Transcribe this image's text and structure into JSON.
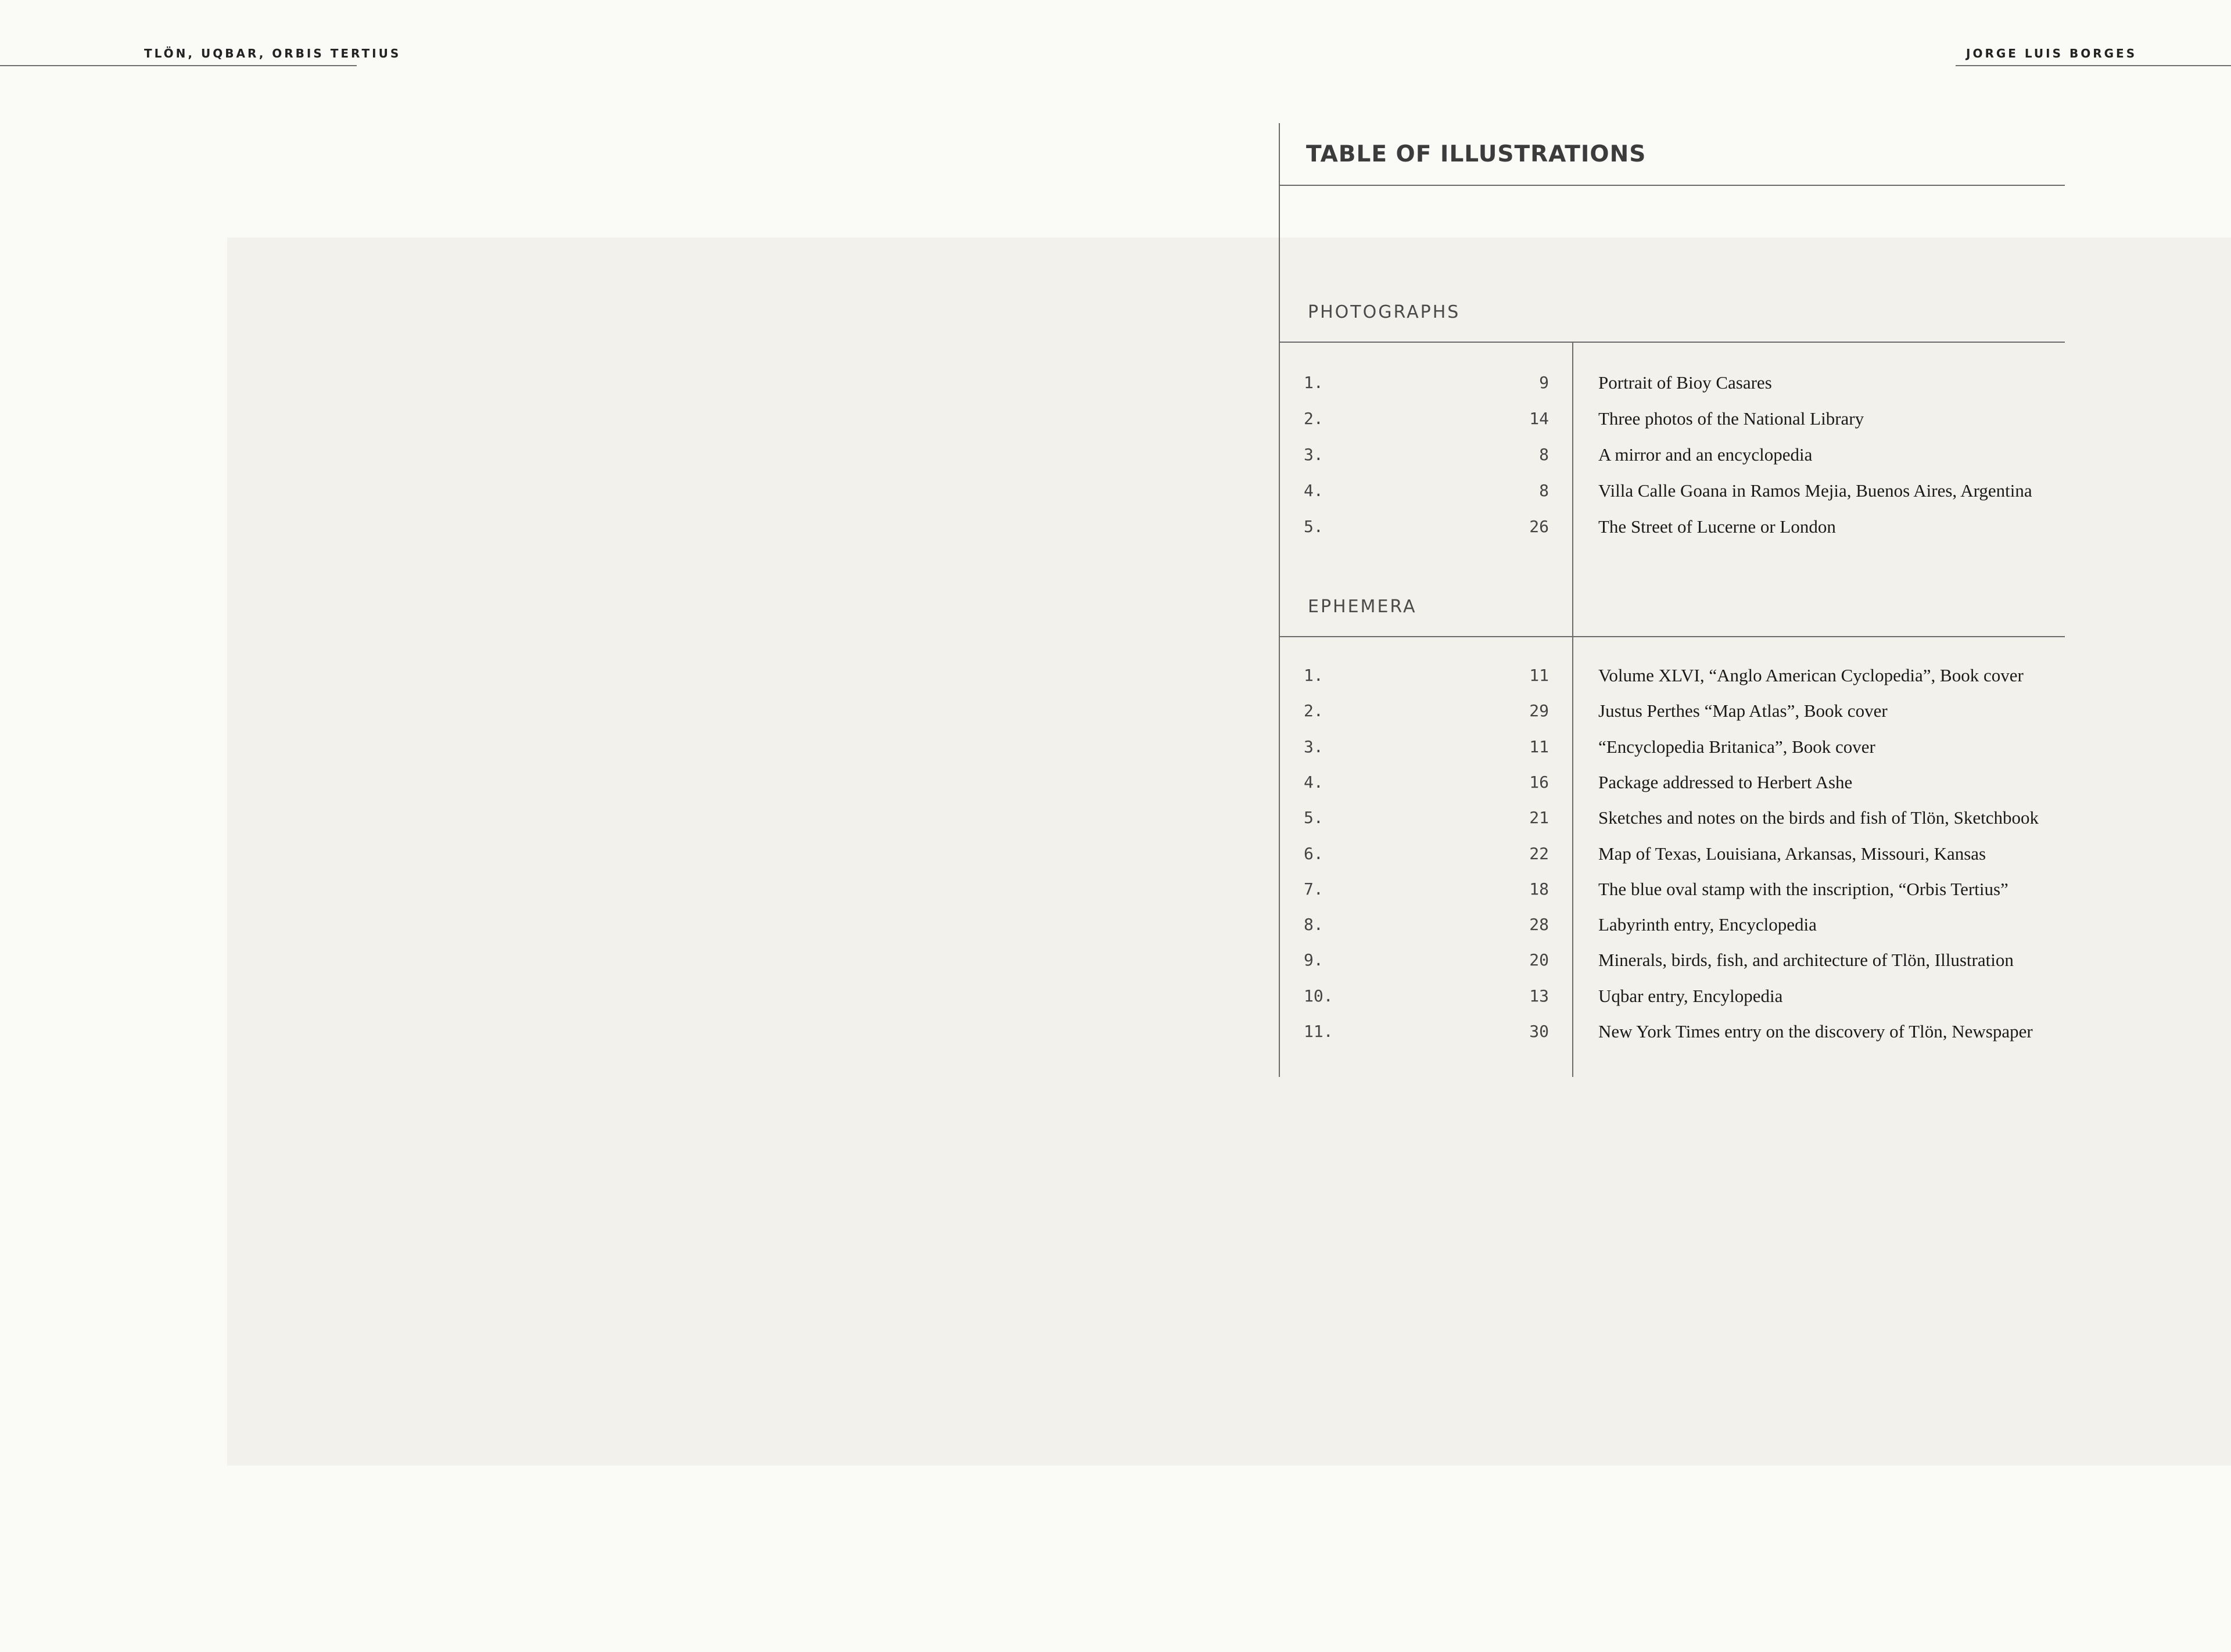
{
  "header": {
    "left": "TLÖN, UQBAR, ORBIS TERTIUS",
    "right": "JORGE LUIS BORGES"
  },
  "toc": {
    "title": "TABLE OF ILLUSTRATIONS",
    "sections": [
      {
        "heading": "PHOTOGRAPHS",
        "items": [
          {
            "num": "1.",
            "page": "9",
            "desc": "Portrait of Bioy Casares"
          },
          {
            "num": "2.",
            "page": "14",
            "desc": "Three photos of the National Library"
          },
          {
            "num": "3.",
            "page": "8",
            "desc": "A mirror and an encyclopedia"
          },
          {
            "num": "4.",
            "page": "8",
            "desc": "Villa Calle Goana in Ramos Mejia, Buenos Aires, Argentina"
          },
          {
            "num": "5.",
            "page": "26",
            "desc": "The Street of Lucerne or London"
          }
        ]
      },
      {
        "heading": "EPHEMERA",
        "items": [
          {
            "num": "1.",
            "page": "11",
            "desc": "Volume XLVI, “Anglo American Cyclopedia”, Book cover"
          },
          {
            "num": "2.",
            "page": "29",
            "desc": "Justus Perthes “Map Atlas”, Book cover"
          },
          {
            "num": "3.",
            "page": "11",
            "desc": "“Encyclopedia Britanica”, Book cover"
          },
          {
            "num": "4.",
            "page": "16",
            "desc": "Package addressed to Herbert Ashe"
          },
          {
            "num": "5.",
            "page": "21",
            "desc": "Sketches and notes on the birds and fish of Tlön, Sketchbook"
          },
          {
            "num": "6.",
            "page": "22",
            "desc": "Map of Texas,  Louisiana, Arkansas, Missouri, Kansas"
          },
          {
            "num": "7.",
            "page": "18",
            "desc": "The blue oval stamp with the inscription, “Orbis Tertius”"
          },
          {
            "num": "8.",
            "page": "28",
            "desc": "Labyrinth entry, Encyclopedia"
          },
          {
            "num": "9.",
            "page": "20",
            "desc": "Minerals, birds, fish, and architecture of Tlön, Illustration"
          },
          {
            "num": "10.",
            "page": "13",
            "desc": "Uqbar entry, Encylopedia"
          },
          {
            "num": "11.",
            "page": "30",
            "desc": "New York Times entry on the discovery of Tlön, Newspaper"
          }
        ]
      }
    ]
  }
}
